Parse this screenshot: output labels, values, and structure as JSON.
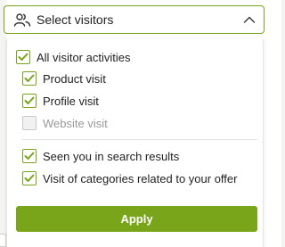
{
  "select": {
    "label": "Select visitors",
    "icon": "users-icon",
    "chevron": "chevron-up-icon"
  },
  "options": [
    {
      "label": "All visitor activities",
      "checked": true
    },
    {
      "label": "Product visit",
      "checked": true
    },
    {
      "label": "Profile visit",
      "checked": true
    },
    {
      "label": "Website visit",
      "checked": false,
      "disabled": true
    },
    {
      "label": "Seen you in search results",
      "checked": true
    },
    {
      "label": "Visit of categories related to your offer",
      "checked": true
    }
  ],
  "apply_label": "Apply",
  "colors": {
    "accent": "#79a51a",
    "text": "#222222",
    "disabled_text": "#9a9a9a"
  }
}
